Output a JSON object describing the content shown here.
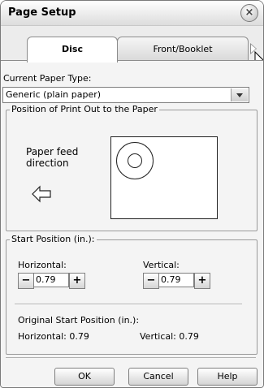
{
  "window": {
    "title": "Page Setup",
    "close_icon": "close-icon"
  },
  "tabs": [
    {
      "label": "Disc",
      "selected": true
    },
    {
      "label": "Front/Booklet",
      "selected": false
    }
  ],
  "paper_type": {
    "label": "Current Paper Type:",
    "value": "Generic (plain paper)"
  },
  "position_group": {
    "title": "Position of Print Out to the Paper",
    "feed_label": "Paper feed\ndirection"
  },
  "start_position": {
    "title": "Start Position (in.):",
    "horizontal_label": "Horizontal:",
    "horizontal_value": "0.79",
    "vertical_label": "Vertical:",
    "vertical_value": "0.79",
    "minus": "−",
    "plus": "+",
    "original_title": "Original Start Position (in.):",
    "original_horizontal": "Horizontal: 0.79",
    "original_vertical": "Vertical: 0.79"
  },
  "buttons": {
    "ok": "OK",
    "cancel": "Cancel",
    "help": "Help"
  }
}
